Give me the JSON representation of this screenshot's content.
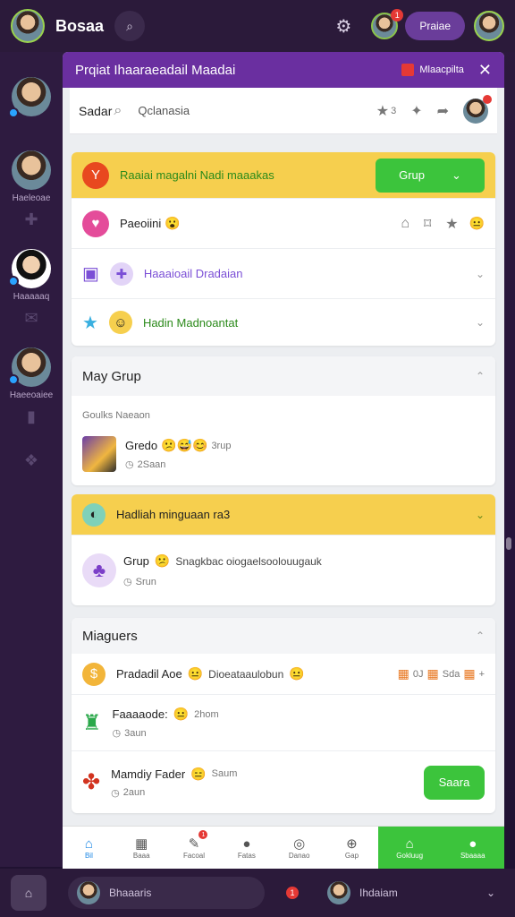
{
  "topbar": {
    "app_name": "Bosaa",
    "pill_label": "Praiae",
    "badge": "1"
  },
  "rail": {
    "items": [
      {
        "label": ""
      },
      {
        "label": "Haeleoae"
      },
      {
        "label": "Haaaaaq"
      },
      {
        "label": "Haeeoaiee"
      }
    ]
  },
  "panel": {
    "title": "Prqiat Ihaaraeadail Maadai",
    "flag_label": "Mlaacpilta",
    "search_label": "Sadar",
    "search_query": "Qclanasia",
    "tool_count": "3",
    "promo": {
      "text": "Raaiai magalni Nadi maaakas",
      "button": "Grup"
    },
    "list": [
      {
        "text": "Paeoiini"
      },
      {
        "text": "Haaaioail Dradaian"
      },
      {
        "text": "Hadin Madnoantat"
      }
    ],
    "group_section": {
      "title": "May Grup",
      "subtitle": "Goulks Naeaon",
      "item_title": "Gredo",
      "item_tag": "3rup",
      "item_meta": "2Saan"
    },
    "gift_section": {
      "title": "Hadliah minguaan ra3",
      "item_title": "Grup",
      "item_desc": "Snagkbac oiogaelsoolouugauk",
      "item_meta": "Srun"
    },
    "members_section": {
      "title": "Miaguers",
      "rows": [
        {
          "title": "Pradadil Aoe",
          "desc": "Dioeataaulobun",
          "c1": "0J",
          "c2": "Sda",
          "c3": "+"
        },
        {
          "title": "Faaaaode:",
          "desc": "2hom",
          "meta": "3aun"
        },
        {
          "title": "Mamdiy Fader",
          "desc": "Saum",
          "meta": "2aun",
          "button": "Saara"
        }
      ]
    },
    "tabs": [
      {
        "label": "Bil"
      },
      {
        "label": "Baaa"
      },
      {
        "label": "Facoal"
      },
      {
        "label": "Fatas"
      },
      {
        "label": "Danao"
      },
      {
        "label": "Gap"
      },
      {
        "label": "Gokluug"
      },
      {
        "label": "Sbaaaa"
      }
    ],
    "tab_badge": "1"
  },
  "bottombar": {
    "left_chip": "Bhaaaris",
    "right_chip": "Ihdaiam",
    "badge": "1"
  },
  "colors": {
    "accent": "#6a2fa0",
    "green": "#3cc43c",
    "yellow": "#f6cf4e"
  }
}
